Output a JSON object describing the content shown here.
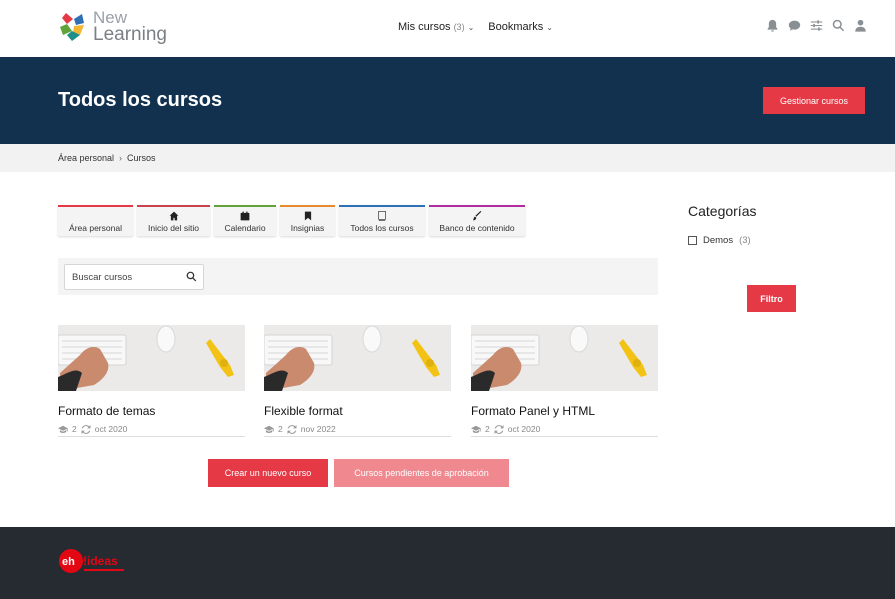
{
  "brand": {
    "line1": "New",
    "line2": "Learning"
  },
  "nav": {
    "my_courses_label": "Mis cursos",
    "my_courses_count": "(3)",
    "bookmarks_label": "Bookmarks"
  },
  "top_icons": [
    "bell-icon",
    "chat-icon",
    "sliders-icon",
    "search-icon",
    "user-icon"
  ],
  "hero": {
    "title": "Todos los cursos",
    "manage_button": "Gestionar cursos"
  },
  "breadcrumb": [
    "Área personal",
    "Cursos"
  ],
  "tiles": [
    {
      "label": "Área personal",
      "icon": "",
      "color": "#e63946"
    },
    {
      "label": "Inicio del sitio",
      "icon": "home-icon",
      "color": "#c8414b"
    },
    {
      "label": "Calendario",
      "icon": "calendar-icon",
      "color": "#5fa33a"
    },
    {
      "label": "Insignias",
      "icon": "bookmark-icon",
      "color": "#e8892e"
    },
    {
      "label": "Todos los cursos",
      "icon": "book-icon",
      "color": "#2f6fb7"
    },
    {
      "label": "Banco de contenido",
      "icon": "brush-icon",
      "color": "#b22ca0"
    }
  ],
  "search": {
    "placeholder": "Buscar cursos"
  },
  "courses": [
    {
      "title": "Formato de temas",
      "students": "2",
      "date": "oct 2020"
    },
    {
      "title": "Flexible format",
      "students": "2",
      "date": "nov 2022"
    },
    {
      "title": "Formato Panel y HTML",
      "students": "2",
      "date": "oct 2020"
    }
  ],
  "actions": {
    "create": "Crear un nuevo curso",
    "pending": "Cursos pendientes de aprobación"
  },
  "sidebar": {
    "title": "Categorías",
    "categories": [
      {
        "label": "Demos",
        "count": "(3)"
      }
    ],
    "filter_button": "Filtro"
  },
  "colors": {
    "accent": "#e63946",
    "hero_bg": "#11314f",
    "footer_bg": "#262b31"
  }
}
